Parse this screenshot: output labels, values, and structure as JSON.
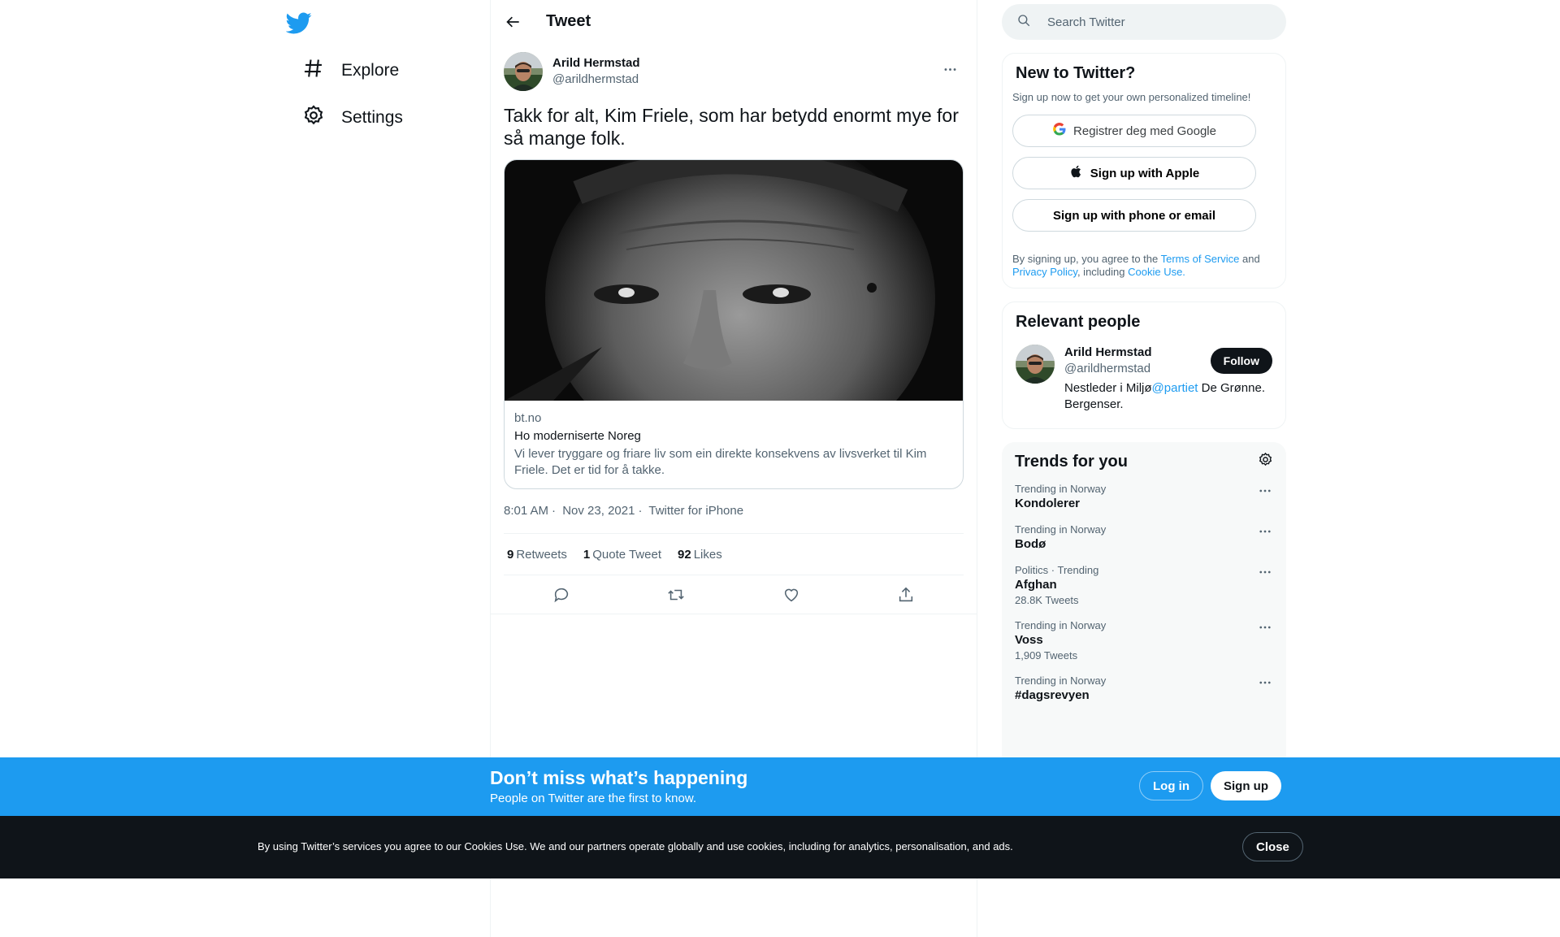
{
  "colors": {
    "accent": "#1d9bf0",
    "text": "#0f1419",
    "secondary": "#536471"
  },
  "nav": {
    "logo_icon": "twitter-bird-icon",
    "items": [
      {
        "label": "Explore",
        "icon": "hashtag-icon"
      },
      {
        "label": "Settings",
        "icon": "gear-icon"
      }
    ]
  },
  "main": {
    "title": "Tweet",
    "tweet": {
      "author_name": "Arild Hermstad",
      "author_handle": "@arildhermstad",
      "text": "Takk for alt, Kim Friele, som har betydd enormt mye for så mange folk.",
      "card": {
        "domain": "bt.no",
        "title": "Ho moderniserte Noreg",
        "description": "Vi lever tryggare og friare liv som ein direkte konsekvens av livsverket til Kim Friele. Det er tid for å takke."
      },
      "time": "8:01 AM",
      "sep": "·",
      "date": "Nov 23, 2021",
      "source": "Twitter for iPhone",
      "stats": [
        {
          "count": "9",
          "label": "Retweets"
        },
        {
          "count": "1",
          "label": "Quote Tweet"
        },
        {
          "count": "92",
          "label": "Likes"
        }
      ]
    }
  },
  "right": {
    "search_placeholder": "Search Twitter",
    "signup_panel": {
      "title": "New to Twitter?",
      "subtitle": "Sign up now to get your own personalized timeline!",
      "google_label": "Registrer deg med Google",
      "apple_label": "Sign up with Apple",
      "email_label": "Sign up with phone or email",
      "legal_prefix": "By signing up, you agree to the ",
      "terms_link": "Terms of Service",
      "legal_and": " and ",
      "privacy_link": "Privacy Policy",
      "legal_including": ", including ",
      "cookie_link": "Cookie Use."
    },
    "relevant": {
      "title": "Relevant people",
      "name": "Arild Hermstad",
      "handle": "@arildhermstad",
      "bio_prefix": "Nestleder i Miljø",
      "bio_mention": "@partiet",
      "bio_suffix": " De Grønne. Bergenser.",
      "follow_label": "Follow"
    },
    "trends": {
      "title": "Trends for you",
      "items": [
        {
          "context": "Trending in Norway",
          "name": "Kondolerer",
          "count": ""
        },
        {
          "context": "Trending in Norway",
          "name": "Bodø",
          "count": ""
        },
        {
          "context": "Politics · Trending",
          "name": "Afghan",
          "count": "28.8K Tweets"
        },
        {
          "context": "Trending in Norway",
          "name": "Voss",
          "count": "1,909 Tweets"
        },
        {
          "context": "Trending in Norway",
          "name": "#dagsrevyen",
          "count": ""
        }
      ]
    }
  },
  "banner": {
    "title": "Don’t miss what’s happening",
    "subtitle": "People on Twitter are the first to know.",
    "login_label": "Log in",
    "signup_label": "Sign up"
  },
  "cookie": {
    "text": "By using Twitter’s services you agree to our Cookies Use. We and our partners operate globally and use cookies, including for analytics, personalisation, and ads.",
    "close_label": "Close"
  }
}
